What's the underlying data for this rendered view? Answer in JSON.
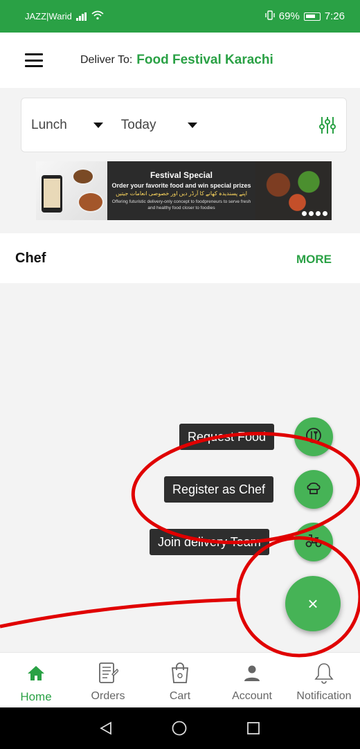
{
  "status_bar": {
    "carrier": "JAZZ|Warid",
    "battery_percent": "69%",
    "time": "7:26"
  },
  "header": {
    "deliver_label": "Deliver To:",
    "location": "Food Festival Karachi",
    "menu_icon": "hamburger-menu-icon"
  },
  "filters": {
    "meal": "Lunch",
    "day": "Today",
    "filter_icon": "sliders-icon"
  },
  "banner": {
    "title": "Festival Special",
    "subtitle": "Order your favorite food and win special prizes",
    "urdu_text": "اپنے پسندیدہ کھانے کا آرڈر دیں اور خصوصی انعامات جیتیں",
    "small_text": "Offering futuristic delivery-only concept to foodpreneurs to serve fresh and healthy food closer to foodies"
  },
  "chef_section": {
    "title": "Chef",
    "more_label": "MORE"
  },
  "fab_menu": {
    "items": [
      {
        "label": "Request Food",
        "icon": "food-request-icon"
      },
      {
        "label": "Register as Chef",
        "icon": "chef-hat-icon"
      },
      {
        "label": "Join delivery Team",
        "icon": "delivery-scooter-icon"
      }
    ],
    "close_symbol": "×"
  },
  "bottom_nav": {
    "items": [
      {
        "label": "Home",
        "icon": "home-icon",
        "active": true
      },
      {
        "label": "Orders",
        "icon": "orders-icon",
        "active": false
      },
      {
        "label": "Cart",
        "icon": "cart-bag-icon",
        "active": false
      },
      {
        "label": "Account",
        "icon": "account-icon",
        "active": false
      },
      {
        "label": "Notification",
        "icon": "bell-icon",
        "active": false
      }
    ]
  },
  "colors": {
    "brand_green": "#2aa145",
    "fab_green": "#46b356",
    "label_dark": "#2e2e2e",
    "annotation_red": "#e00000"
  }
}
